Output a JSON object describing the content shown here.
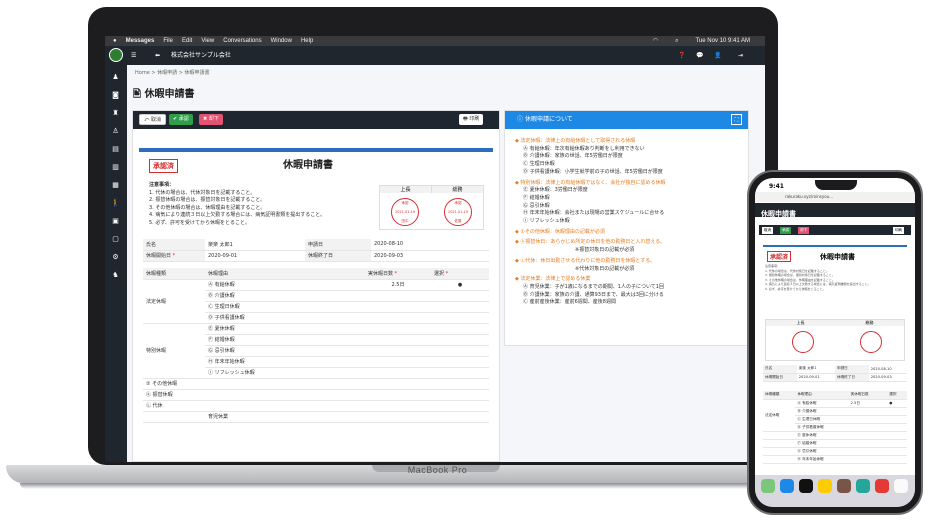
{
  "mac": {
    "menu": [
      "Messages",
      "File",
      "Edit",
      "View",
      "Conversations",
      "Window",
      "Help"
    ],
    "clock": "Tue Nov 10  9:41 AM"
  },
  "app": {
    "company": "株式会社サンプル会社",
    "breadcrumb": [
      "Home",
      "休暇申請",
      "休暇申請書"
    ],
    "page_title": "休暇申請書"
  },
  "toolbar": {
    "withdraw": "取消",
    "approve": "承認",
    "reject": "却下",
    "print": "印刷"
  },
  "doc": {
    "status_stamp": "承認済",
    "title": "休暇申請書",
    "notes_title": "注意事項：",
    "notes": [
      "1. 代休の場合は、代休対象日を記載すること。",
      "2. 振替休暇の場合は、振替対象日を記載すること。",
      "3. その他休暇の場合は、休暇理由を記載すること。",
      "4. 病気により連続３日以上欠勤する場合には、病気証明書類を提出すること。",
      "5. 必ず、許可を受けてから休暇をとること。"
    ],
    "stamps": [
      {
        "role": "上長",
        "date": "2021.01.19",
        "name": "田中"
      },
      {
        "role": "総務",
        "date": "2021.01.19",
        "name": "佐藤"
      }
    ],
    "fields": {
      "name_label": "氏名",
      "name": "楽楽 太郎1",
      "applied_label": "申請日",
      "applied": "2020-08-10",
      "start_label": "休暇開始日",
      "start": "2020-09-01",
      "end_label": "休暇終了日",
      "end": "2020-09-03"
    },
    "table_headers": {
      "type": "休暇種類",
      "reason": "休暇理由",
      "days": "実休暇日数",
      "select": "選択"
    },
    "groups": [
      {
        "name": "法定休暇",
        "items": [
          "Ⓐ 有給休暇",
          "Ⓑ 介護休暇",
          "Ⓒ 生理日休暇",
          "Ⓓ 子供看護休暇"
        ]
      },
      {
        "name": "特別休暇",
        "items": [
          "Ⓔ 夏休休暇",
          "Ⓕ 結婚休暇",
          "Ⓖ 忌引休暇",
          "Ⓗ 年末年始休暇",
          "Ⓘ リフレッシュ休暇"
        ]
      }
    ],
    "selected_days": "2.5日",
    "selected_mark": "●",
    "others": [
      "② その他休暇",
      "ⓚ 振替休暇",
      "Ⓛ 代休"
    ],
    "last_item": "育児休業"
  },
  "info": {
    "title": "休暇申請について",
    "lines": [
      {
        "t": "◆ 法定休暇：法律上の有給休暇として取得される休暇",
        "c": "or"
      },
      {
        "t": "Ⓐ 有給休暇：年次有給休暇あり判断をし利用できない",
        "c": ""
      },
      {
        "t": "Ⓑ 介護休暇：家族の世話、年5労働日が限度",
        "c": ""
      },
      {
        "t": "Ⓒ 生理日休暇",
        "c": ""
      },
      {
        "t": "Ⓓ 子供看護休暇：小学生就学前の子の世話、年5労働日が限度",
        "c": ""
      },
      {
        "t": "◆ 特別休暇：法律上の有給休暇ではなく、会社が独自に認める休暇",
        "c": "or"
      },
      {
        "t": "Ⓔ 夏休休暇：3労働日が限度",
        "c": ""
      },
      {
        "t": "Ⓕ 結婚休暇",
        "c": ""
      },
      {
        "t": "Ⓖ 忌引休暇",
        "c": ""
      },
      {
        "t": "Ⓗ 年末年始休暇：会社または現場の営業スケジュールに合せる",
        "c": ""
      },
      {
        "t": "Ⓘ リフレッシュ休暇",
        "c": ""
      },
      {
        "t": "◆ ①その他休暇：休暇理由の記載が必須",
        "c": "or"
      },
      {
        "t": "◆ ⓚ振替休日：あらかじめ所定の休日を他の勤務日と入れ替える。",
        "c": "or"
      },
      {
        "t": "※振替対象日の記載が必須",
        "c": "ind"
      },
      {
        "t": "◆ Ⓛ代休：休日出勤させる代わりに他の勤務日を休暇とする。",
        "c": "or"
      },
      {
        "t": "※代休対象日の記載が必須",
        "c": "ind"
      },
      {
        "t": "◆ 法定休業：法律上で認める休業",
        "c": "or"
      },
      {
        "t": "Ⓐ 育児休業：子が1歳になるまでの期間、1人の子について1回",
        "c": ""
      },
      {
        "t": "Ⓑ 介護休業：家族の介護、通算93日まで、最大は3回に分ける",
        "c": ""
      },
      {
        "t": "Ⓒ 産前産後休業：産前6週間、産後8週間",
        "c": ""
      }
    ]
  },
  "macbook_label": "MacBook Pro",
  "phone": {
    "time": "9:41",
    "url": "rakuraku.xyz/roinsyou...",
    "title": "休暇申請書",
    "status_stamp": "承認済",
    "doc_title": "休暇申請書",
    "stamp_roles": [
      "上長",
      "総務"
    ],
    "name_label": "氏名",
    "name": "楽楽 太郎1",
    "applied_label": "申請日",
    "applied": "2020-08-10",
    "start_label": "休暇開始日",
    "start": "2020-09-01",
    "end_label": "休暇終了日",
    "end": "2020-09-03",
    "headers": {
      "type": "休暇種類",
      "reason": "休暇理由",
      "days": "実休暇日数",
      "select": "選択"
    },
    "group": "法定休暇",
    "items": [
      "Ⓐ 有給休暇",
      "Ⓑ 介護休暇",
      "Ⓒ 生理日休暇",
      "Ⓓ 子供看護休暇",
      "Ⓔ 夏休休暇",
      "Ⓕ 結婚休暇",
      "Ⓖ 忌引休暇",
      "Ⓗ 年末年始休暇"
    ],
    "days": "2.5日"
  }
}
